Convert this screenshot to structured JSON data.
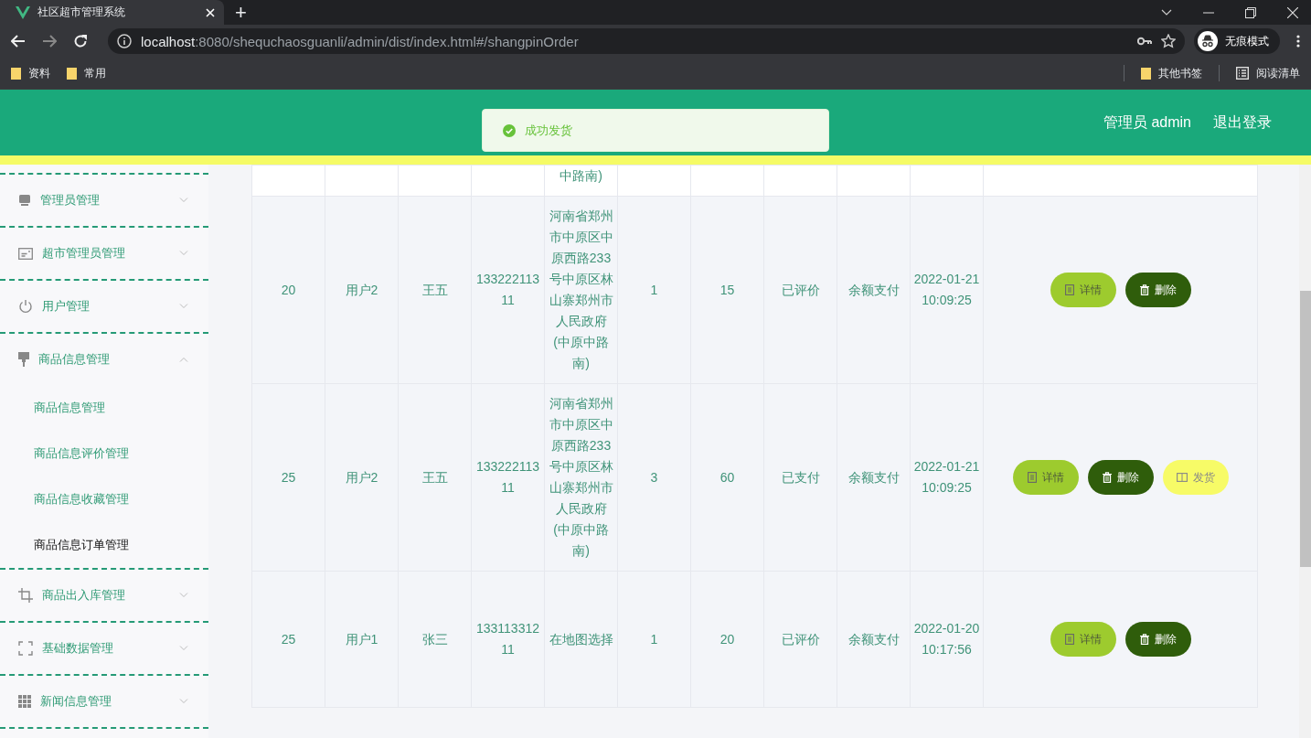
{
  "browser": {
    "tab_title": "社区超市管理系统",
    "new_tab": "+",
    "url_host": "localhost",
    "url_path": ":8080/shequchaosguanli/admin/dist/index.html#/shangpinOrder",
    "incognito_label": "无痕模式",
    "bookmarks": [
      "资料",
      "常用"
    ],
    "other_bookmarks": "其他书签",
    "reading_list": "阅读清单"
  },
  "header": {
    "user": "管理员 admin",
    "logout": "退出登录"
  },
  "toast": {
    "message": "成功发货"
  },
  "sidebar": {
    "items": [
      {
        "label": "管理员管理",
        "expanded": false
      },
      {
        "label": "超市管理员管理",
        "expanded": false
      },
      {
        "label": "用户管理",
        "expanded": false
      },
      {
        "label": "商品信息管理",
        "expanded": true,
        "children": [
          {
            "label": "商品信息管理",
            "selected": false
          },
          {
            "label": "商品信息评价管理",
            "selected": false
          },
          {
            "label": "商品信息收藏管理",
            "selected": false
          },
          {
            "label": "商品信息订单管理",
            "selected": true
          }
        ]
      },
      {
        "label": "商品出入库管理",
        "expanded": false
      },
      {
        "label": "基础数据管理",
        "expanded": false
      },
      {
        "label": "新闻信息管理",
        "expanded": false
      }
    ]
  },
  "table": {
    "top_row_fragment": {
      "column_5": "中路南)"
    },
    "rows": [
      {
        "cells": [
          "20",
          "用户2",
          "王五",
          "13322211311",
          "河南省郑州市中原区中原西路233号中原区林山寨郑州市人民政府(中原中路南)",
          "1",
          "15",
          "已评价",
          "余额支付",
          "2022-01-21 10:09:25"
        ],
        "actions": [
          {
            "kind": "detail",
            "label": "详情"
          },
          {
            "kind": "delete",
            "label": "删除"
          }
        ]
      },
      {
        "cells": [
          "25",
          "用户2",
          "王五",
          "13322211311",
          "河南省郑州市中原区中原西路233号中原区林山寨郑州市人民政府(中原中路南)",
          "3",
          "60",
          "已支付",
          "余额支付",
          "2022-01-21 10:09:25"
        ],
        "actions": [
          {
            "kind": "detail",
            "label": "详情"
          },
          {
            "kind": "delete",
            "label": "删除"
          },
          {
            "kind": "ship",
            "label": "发货"
          }
        ]
      },
      {
        "cells": [
          "25",
          "用户1",
          "张三",
          "13311331211",
          "在地图选择",
          "1",
          "20",
          "已评价",
          "余额支付",
          "2022-01-20 10:17:56"
        ],
        "actions": [
          {
            "kind": "detail",
            "label": "详情"
          },
          {
            "kind": "delete",
            "label": "删除"
          }
        ]
      }
    ]
  }
}
